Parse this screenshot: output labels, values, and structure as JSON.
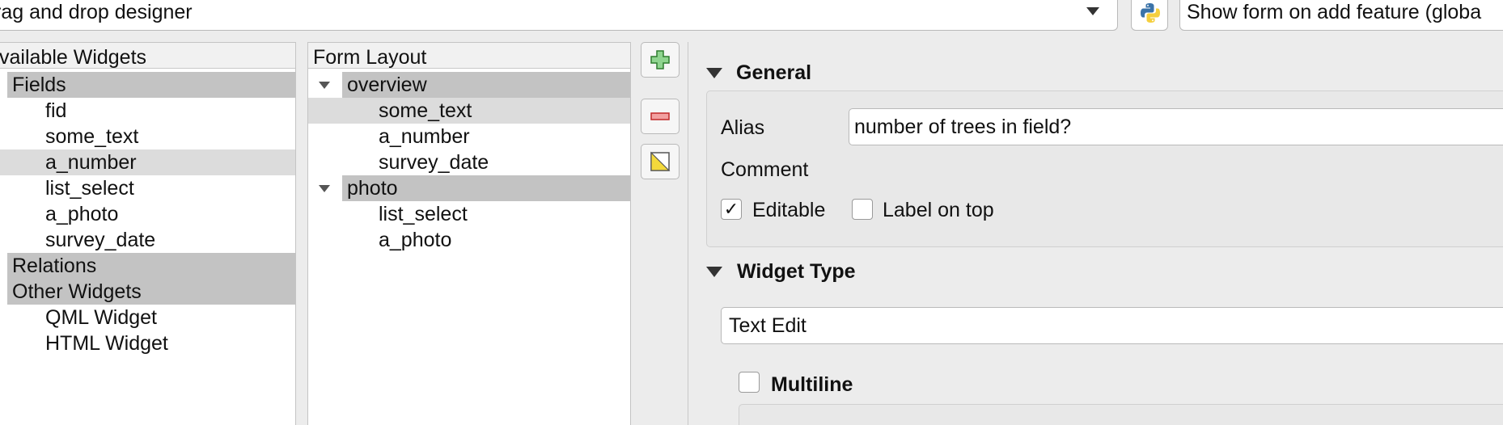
{
  "topbar": {
    "designer_combo": "rag and drop designer",
    "showform_combo": "Show form on add feature (globa"
  },
  "available_widgets": {
    "header": "vailable Widgets",
    "groups": {
      "fields": "Fields",
      "relations": "Relations",
      "other": "Other Widgets"
    },
    "fields": [
      "fid",
      "some_text",
      "a_number",
      "list_select",
      "a_photo",
      "survey_date"
    ],
    "other_widgets": [
      "QML Widget",
      "HTML Widget"
    ]
  },
  "form_layout": {
    "header": "Form Layout",
    "groups": [
      {
        "name": "overview",
        "items": [
          "some_text",
          "a_number",
          "survey_date"
        ]
      },
      {
        "name": "photo",
        "items": [
          "list_select",
          "a_photo"
        ]
      }
    ]
  },
  "general": {
    "title": "General",
    "alias_label": "Alias",
    "alias_value": "number of trees in field?",
    "comment_label": "Comment",
    "editable_label": "Editable",
    "editable_checked": "✓",
    "label_on_top_label": "Label on top"
  },
  "widget_type": {
    "title": "Widget Type",
    "selected": "Text Edit",
    "multiline_label": "Multiline"
  },
  "colors": {
    "group_row": "#c3c3c3",
    "selected_row": "#dcdcdc"
  }
}
